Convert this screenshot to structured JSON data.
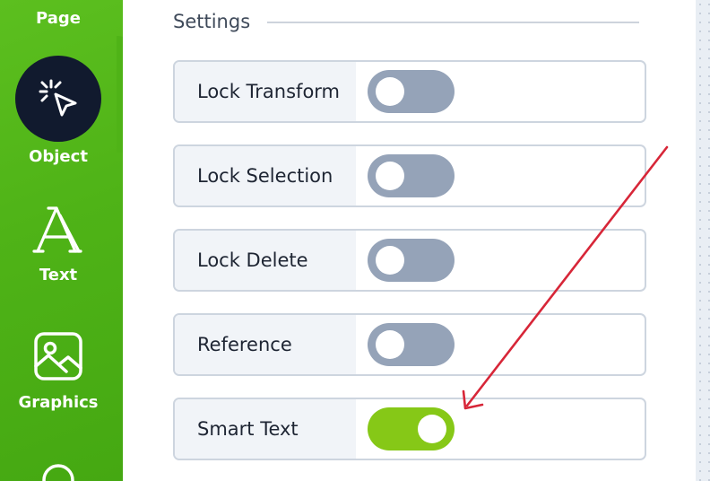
{
  "sidebar": {
    "items": [
      {
        "label": "Page"
      },
      {
        "label": "Object"
      },
      {
        "label": "Text"
      },
      {
        "label": "Graphics"
      }
    ]
  },
  "settings": {
    "title": "Settings",
    "rows": [
      {
        "label": "Lock Transform",
        "state": "off"
      },
      {
        "label": "Lock Selection",
        "state": "off"
      },
      {
        "label": "Lock Delete",
        "state": "off"
      },
      {
        "label": "Reference",
        "state": "off"
      },
      {
        "label": "Smart Text",
        "state": "on"
      }
    ]
  },
  "colors": {
    "sidebar_green": "#4fb317",
    "toggle_off": "#95a3b8",
    "toggle_on": "#86c817",
    "annotation_arrow": "#d72638"
  }
}
